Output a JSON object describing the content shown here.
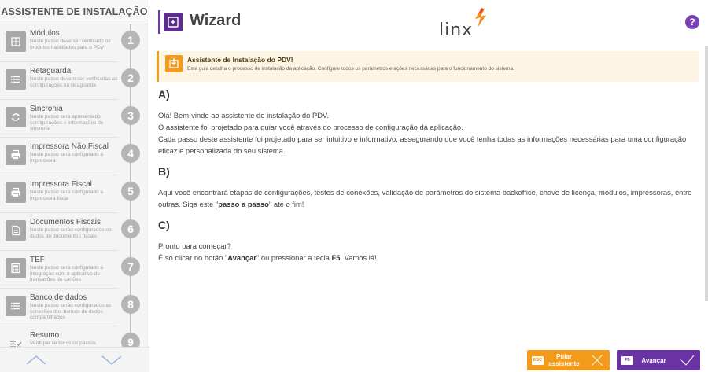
{
  "sidebar": {
    "title": "ASSISTENTE DE INSTALAÇÃO",
    "steps": [
      {
        "num": "1",
        "title": "Módulos",
        "desc": "Neste passo deve ser verificado os módulos habilitados para o PDV",
        "icon": "modules-icon"
      },
      {
        "num": "2",
        "title": "Retaguarda",
        "desc": "Neste passo devem ser verificadas as configurações na retaguarda",
        "icon": "list-icon"
      },
      {
        "num": "3",
        "title": "Sincronia",
        "desc": "Neste passo será apresentado configurações e informações de sincronia",
        "icon": "sync-icon"
      },
      {
        "num": "4",
        "title": "Impressora Não Fiscal",
        "desc": "Neste passo será configurado a impressora",
        "icon": "printer-icon"
      },
      {
        "num": "5",
        "title": "Impressora Fiscal",
        "desc": "Neste passo será configurado a impressora fiscal",
        "icon": "printer-icon"
      },
      {
        "num": "6",
        "title": "Documentos Fiscais",
        "desc": "Neste passo serão configurados os dados de documentos fiscais",
        "icon": "document-icon"
      },
      {
        "num": "7",
        "title": "TEF",
        "desc": "Neste passo será configurado a integração com o aplicativo de transações de cartões",
        "icon": "card-terminal-icon"
      },
      {
        "num": "8",
        "title": "Banco de dados",
        "desc": "Neste passo serão configurados as conexões dos bancos de dados compartilhados",
        "icon": "database-icon"
      },
      {
        "num": "9",
        "title": "Resumo",
        "desc": "Verifique se todos os passos",
        "icon": "checklist-icon"
      }
    ]
  },
  "header": {
    "title": "Wizard",
    "logo_text": "linx",
    "help_label": "?"
  },
  "banner": {
    "title": "Assistente de Instalação do PDV!",
    "text": "Este guia detalha o processo de instalação da aplicação. Configure todos os parâmetros e ações necessárias para o funcionamento do sistema."
  },
  "content": {
    "a_head": "A)",
    "a_line1": "Olá! Bem-vindo ao assistente de instalação do PDV.",
    "a_line2": "O assistente foi projetado para guiar você através do processo de configuração da aplicação.",
    "a_line3": "Cada passo deste assistente foi projetado para ser intuitivo e informativo, assegurando que você tenha todas as informações necessárias para uma configuração eficaz e personalizada do seu sistema.",
    "b_head": "B)",
    "b_text1": "Aqui você encontrará etapas de configurações, testes de conexões, validação de parâmetros do sistema backoffice, chave de licença, módulos, impressoras, entre outras. Siga este \"",
    "b_bold": "passo a passo",
    "b_text2": "\" até o fim!",
    "c_head": "C)",
    "c_line1": "Pronto para começar?",
    "c_text1": "É só clicar no botão \"",
    "c_bold1": "Avançar",
    "c_text2": "\" ou pressionar a tecla ",
    "c_bold2": "F5",
    "c_text3": ". Vamos lá!"
  },
  "buttons": {
    "skip_key": "ESC",
    "skip_label": "Pular assistente",
    "next_key": "F5",
    "next_label": "Avançar"
  },
  "colors": {
    "accent_purple": "#6a33a3",
    "accent_orange": "#f39a1b",
    "banner_bg": "#fdf4e3"
  }
}
